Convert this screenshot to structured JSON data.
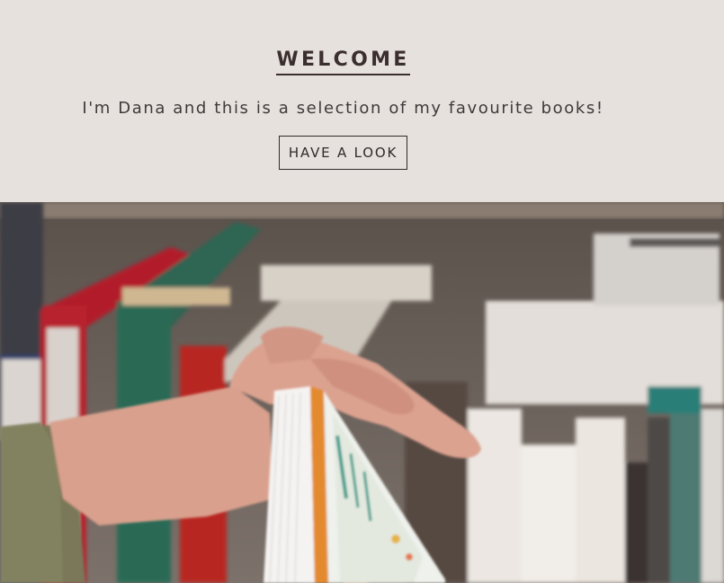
{
  "hero": {
    "title": "WELCOME",
    "tagline": "I'm Dana and this is a selection of my favourite books!",
    "cta_label": "HAVE A LOOK"
  },
  "colors": {
    "background": "#e6e1dd",
    "text": "#3b2e2e",
    "button_border": "#2f2b2b"
  }
}
